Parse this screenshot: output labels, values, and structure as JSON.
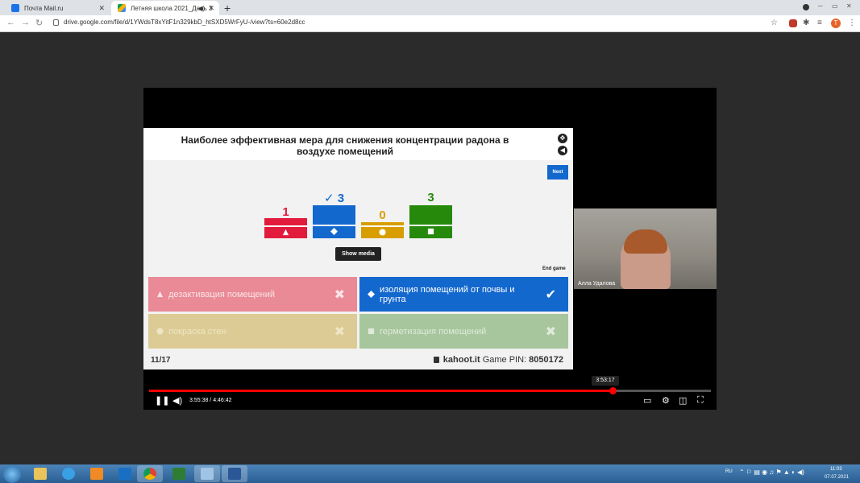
{
  "browser": {
    "tabs": [
      {
        "title": "Почта Mail.ru",
        "close": "✕"
      },
      {
        "title": "Летняя школа 2021_День 3",
        "close": "✕"
      }
    ],
    "new_tab": "+",
    "url": "drive.google.com/file/d/1YWdsT8xYitF1n329kbD_htSXD5WrFyU-/view?ts=60e2d8cc",
    "profile_initial": "Т"
  },
  "slide": {
    "question": "Наиболее эффективная мера для снижения концентрации радона в воздухе помещений",
    "next_label": "Next",
    "show_media_label": "Show media",
    "end_game_label": "End game",
    "results": [
      {
        "count": "1",
        "color": "#e21b3c",
        "symbol": "triangle",
        "correct": false
      },
      {
        "count": "3",
        "color": "#1368ce",
        "symbol": "diamond",
        "correct": true,
        "check": "✓"
      },
      {
        "count": "0",
        "color": "#d89e00",
        "symbol": "circle",
        "correct": false
      },
      {
        "count": "3",
        "color": "#26890c",
        "symbol": "square",
        "correct": false
      }
    ],
    "answers": [
      {
        "text": "дезактивация помещений",
        "mark": "✖",
        "correct": false
      },
      {
        "text": "изоляция помещений от почвы и грунта",
        "mark": "✔",
        "correct": true
      },
      {
        "text": "покраска стен",
        "mark": "✖",
        "correct": false
      },
      {
        "text": "герметизация помещений",
        "mark": "✖",
        "correct": false
      }
    ],
    "progress": "11/17",
    "site": "kahoot.it",
    "pin_label": "Game PIN:",
    "pin": "8050172"
  },
  "webcam": {
    "name": "Алла Удалова"
  },
  "player": {
    "hover_time": "3:53:17",
    "time_display": "3:55:38 / 4:46:42",
    "played_fraction": 0.825
  },
  "taskbar": {
    "lang": "RU",
    "time": "11:03",
    "date": "07.07.2021"
  }
}
